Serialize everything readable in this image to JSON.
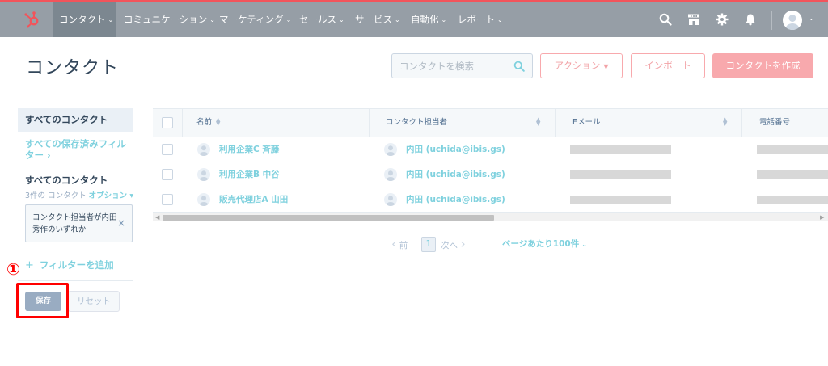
{
  "nav": {
    "items": [
      {
        "label": "コンタクト",
        "active": true
      },
      {
        "label": "コミュニケーション"
      },
      {
        "label": "マーケティング"
      },
      {
        "label": "セールス"
      },
      {
        "label": "サービス"
      },
      {
        "label": "自動化"
      },
      {
        "label": "レポート"
      }
    ],
    "chevron": "⌄",
    "icons": [
      "search-icon",
      "marketplace-icon",
      "settings-gear-icon",
      "notifications-bell-icon"
    ]
  },
  "header": {
    "title": "コンタクト",
    "search_placeholder": "コンタクトを検索",
    "actions_label": "アクション",
    "import_label": "インポート",
    "create_label": "コンタクトを作成"
  },
  "sidebar": {
    "all_contacts_tab": "すべてのコンタクト",
    "saved_filters_link": "すべての保存済みフィルター ›",
    "current_view_heading": "すべてのコンタクト",
    "count_text": "3件の コンタクト",
    "options_label": "オプション ▾",
    "filter_chip_text": "コンタクト担当者が内田 秀作のいずれか",
    "filter_chip_close": "×",
    "add_filter_plus": "+",
    "add_filter_label": "フィルターを追加",
    "save_label": "保存",
    "reset_label": "リセット"
  },
  "annotation": {
    "number": "①"
  },
  "table": {
    "columns": [
      "名前",
      "コンタクト担当者",
      "Eメール",
      "電話番号"
    ],
    "rows": [
      {
        "name": "利用企業C 斉藤",
        "owner": "内田 (uchida@ibis.gs)"
      },
      {
        "name": "利用企業B 中谷",
        "owner": "内田 (uchida@ibis.gs)"
      },
      {
        "name": "販売代理店A 山田",
        "owner": "内田 (uchida@ibis.gs)"
      }
    ]
  },
  "pagination": {
    "prev_label": "前",
    "current_page": "1",
    "next_label": "次へ",
    "per_page_label": "ページあたり100件"
  },
  "colors": {
    "accent_teal": "#7fd1de",
    "primary_pink": "#f8a9ad",
    "nav_gray": "#969ea6",
    "highlight_red": "#ff0000"
  }
}
